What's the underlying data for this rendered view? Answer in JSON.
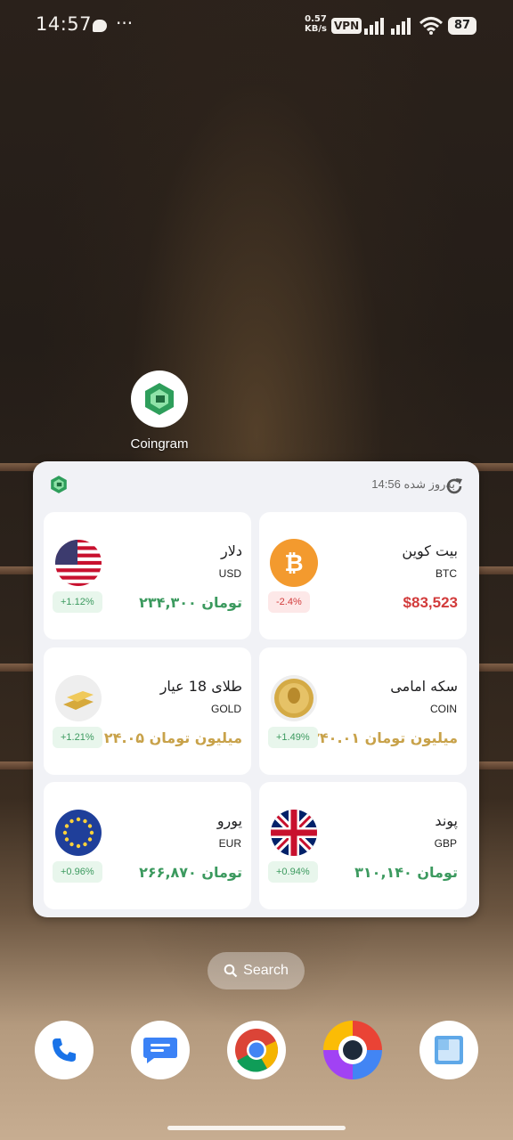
{
  "status_bar": {
    "time": "14:57",
    "speed_value": "0.57",
    "speed_unit": "KB/s",
    "vpn": "VPN",
    "battery": "87"
  },
  "home_app": {
    "label": "Coingram",
    "icon": "coingram-logo"
  },
  "widget": {
    "updated_label": "به‌روز شده",
    "updated_time": "14:56",
    "cards": [
      {
        "name": "بیت کوین",
        "code": "BTC",
        "price": "$83,523",
        "change": "-2.4%",
        "direction": "down",
        "icon": "bitcoin-icon"
      },
      {
        "name": "دلار",
        "code": "USD",
        "price": "۲۳۴,۳۰۰ تومان",
        "change": "+1.12%",
        "direction": "up",
        "icon": "us-flag-icon"
      },
      {
        "name": "سکه امامی",
        "code": "COIN",
        "price": "۲۴۰.۰۱ میلیون تومان",
        "change": "+1.49%",
        "direction": "up",
        "icon": "gold-coin-icon"
      },
      {
        "name": "طلای 18 عیار",
        "code": "GOLD",
        "price": "۲۴.۰۵ میلیون تومان",
        "change": "+1.21%",
        "direction": "up",
        "icon": "gold-bar-icon"
      },
      {
        "name": "پوند",
        "code": "GBP",
        "price": "۳۱۰,۱۴۰ تومان",
        "change": "+0.94%",
        "direction": "up",
        "icon": "uk-flag-icon"
      },
      {
        "name": "یورو",
        "code": "EUR",
        "price": "۲۶۶,۸۷۰ تومان",
        "change": "+0.96%",
        "direction": "up",
        "icon": "eu-flag-icon"
      }
    ]
  },
  "search": {
    "label": "Search"
  },
  "dock": [
    "phone-icon",
    "messages-icon",
    "chrome-icon",
    "browser-icon",
    "gallery-icon"
  ],
  "colors": {
    "green": "#3c9a5f",
    "red": "#d23b3b",
    "gold": "#c8a24a",
    "widget_bg": "#f1f2f6"
  }
}
